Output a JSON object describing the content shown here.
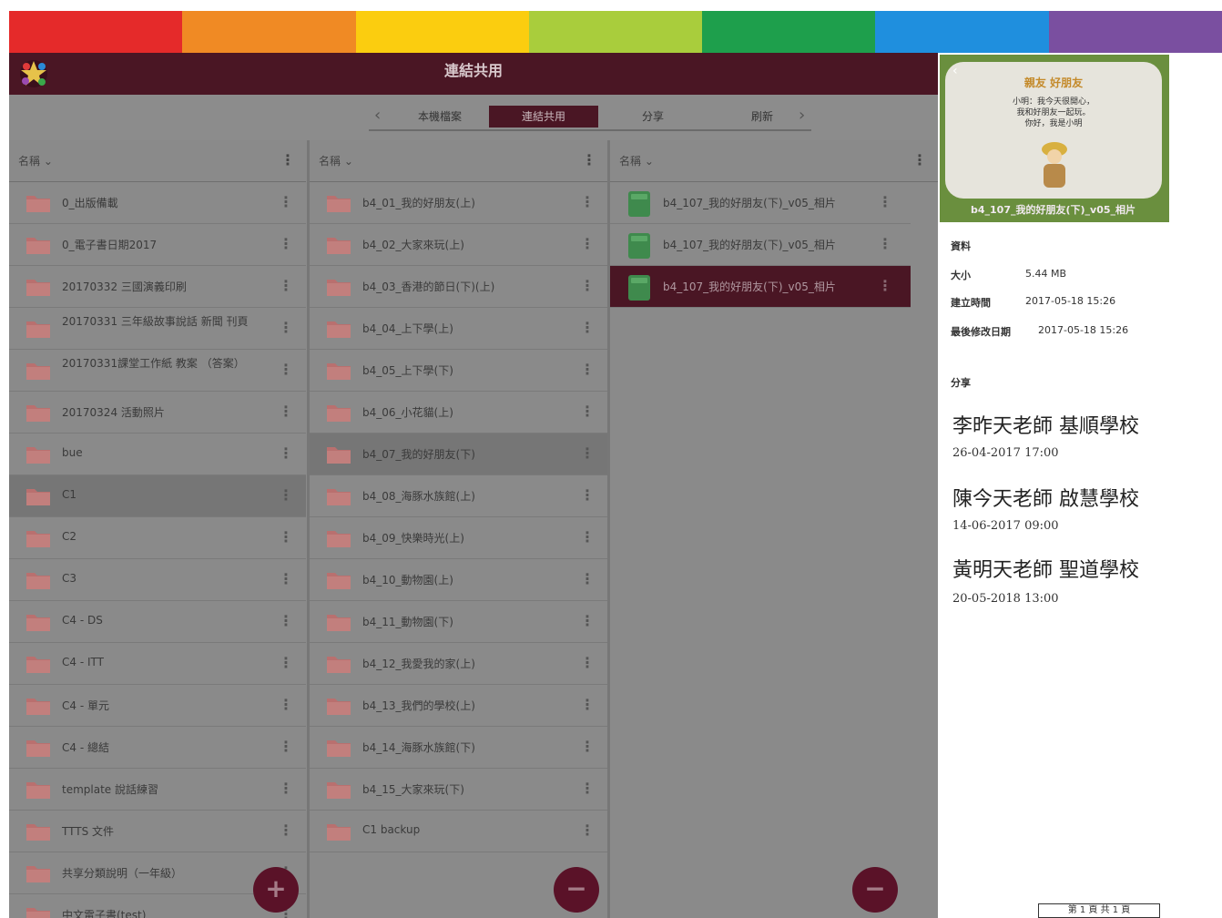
{
  "rainbow_colors": [
    "#e52a2a",
    "#f08a24",
    "#fbcd0f",
    "#a9cd3c",
    "#1e9f4c",
    "#1f8fde",
    "#7a4fa0"
  ],
  "colors": {
    "titlebar": "#4a1624",
    "panel": "#8a8a8a",
    "folder": "#b9706f",
    "file": "#3f8a4d",
    "fab": "#5a1228"
  },
  "header": {
    "title": "連結共用",
    "logo_icon": "star-logo-icon"
  },
  "tabs": [
    {
      "label": "本機檔案",
      "active": false
    },
    {
      "label": "連結共用",
      "active": true
    },
    {
      "label": "分享",
      "active": false
    },
    {
      "label": "刷新",
      "active": false
    }
  ],
  "columns": [
    {
      "header": "名稱 ⌄",
      "items": [
        {
          "label": "0_出版備載",
          "state": ""
        },
        {
          "label": "0_電子書日期2017",
          "state": ""
        },
        {
          "label": "20170332 三國演義印刷",
          "state": ""
        },
        {
          "label": "20170331 三年級故事說話 新聞 刊頁",
          "state": "",
          "multiline": true
        },
        {
          "label": "20170331課堂工作紙 教案 （答案）",
          "state": "",
          "multiline": true
        },
        {
          "label": "20170324 活動照片",
          "state": ""
        },
        {
          "label": "bue",
          "state": ""
        },
        {
          "label": "C1",
          "state": "hl"
        },
        {
          "label": "C2",
          "state": ""
        },
        {
          "label": "C3",
          "state": ""
        },
        {
          "label": "C4 - DS",
          "state": ""
        },
        {
          "label": "C4 - ITT",
          "state": ""
        },
        {
          "label": "C4 - 單元",
          "state": ""
        },
        {
          "label": "C4 - 總結",
          "state": ""
        },
        {
          "label": "template 說話練習",
          "state": ""
        },
        {
          "label": "TTTS 文件",
          "state": ""
        },
        {
          "label": "共享分類說明（一年級）",
          "state": ""
        },
        {
          "label": "中文電子書(test)",
          "state": ""
        }
      ]
    },
    {
      "header": "名稱 ⌄",
      "items": [
        {
          "label": "b4_01_我的好朋友(上)",
          "state": ""
        },
        {
          "label": "b4_02_大家來玩(上)",
          "state": ""
        },
        {
          "label": "b4_03_香港的節日(下)(上)",
          "state": ""
        },
        {
          "label": "b4_04_上下學(上)",
          "state": ""
        },
        {
          "label": "b4_05_上下學(下)",
          "state": ""
        },
        {
          "label": "b4_06_小花貓(上)",
          "state": ""
        },
        {
          "label": "b4_07_我的好朋友(下)",
          "state": "hl"
        },
        {
          "label": "b4_08_海豚水族館(上)",
          "state": ""
        },
        {
          "label": "b4_09_快樂時光(上)",
          "state": ""
        },
        {
          "label": "b4_10_動物園(上)",
          "state": ""
        },
        {
          "label": "b4_11_動物園(下)",
          "state": ""
        },
        {
          "label": "b4_12_我愛我的家(上)",
          "state": ""
        },
        {
          "label": "b4_13_我們的學校(上)",
          "state": ""
        },
        {
          "label": "b4_14_海豚水族館(下)",
          "state": ""
        },
        {
          "label": "b4_15_大家來玩(下)",
          "state": ""
        },
        {
          "label": "C1 backup",
          "state": ""
        }
      ]
    },
    {
      "header": "名稱 ⌄",
      "items": [
        {
          "label": "b4_107_我的好朋友(下)_v05_相片",
          "state": ""
        },
        {
          "label": "b4_107_我的好朋友(下)_v05_相片",
          "state": ""
        },
        {
          "label": "b4_107_我的好朋友(下)_v05_相片",
          "state": "sel"
        }
      ]
    }
  ],
  "fabs": [
    {
      "name": "add-button",
      "symbol": "+"
    },
    {
      "name": "remove-button",
      "symbol": "−"
    },
    {
      "name": "remove-file-button",
      "symbol": "−"
    }
  ],
  "side": {
    "preview_heading": "親友 好朋友",
    "preview_lines": [
      "小明：我今天很開心，",
      "我和好朋友一起玩。",
      "你好，我是小明"
    ],
    "preview_caption": "b4_107_我的好朋友(下)_v05_相片",
    "info_heading": "資料",
    "meta": [
      {
        "label": "大小",
        "value": "5.44 MB"
      },
      {
        "label": "建立時間",
        "value": "2017-05-18 15:26"
      },
      {
        "label": "最後修改日期",
        "value": "2017-05-18 15:26"
      }
    ],
    "shared_heading": "分享",
    "shares": [
      {
        "name": "李昨天老師 基順學校",
        "date": "26-04-2017 17:00"
      },
      {
        "name": "陳今天老師 啟慧學校",
        "date": "14-06-2017 09:00"
      },
      {
        "name": "黃明天老師 聖道學校",
        "date": "20-05-2018 13:00"
      }
    ],
    "footer": "第 1 頁 共 1 頁"
  }
}
